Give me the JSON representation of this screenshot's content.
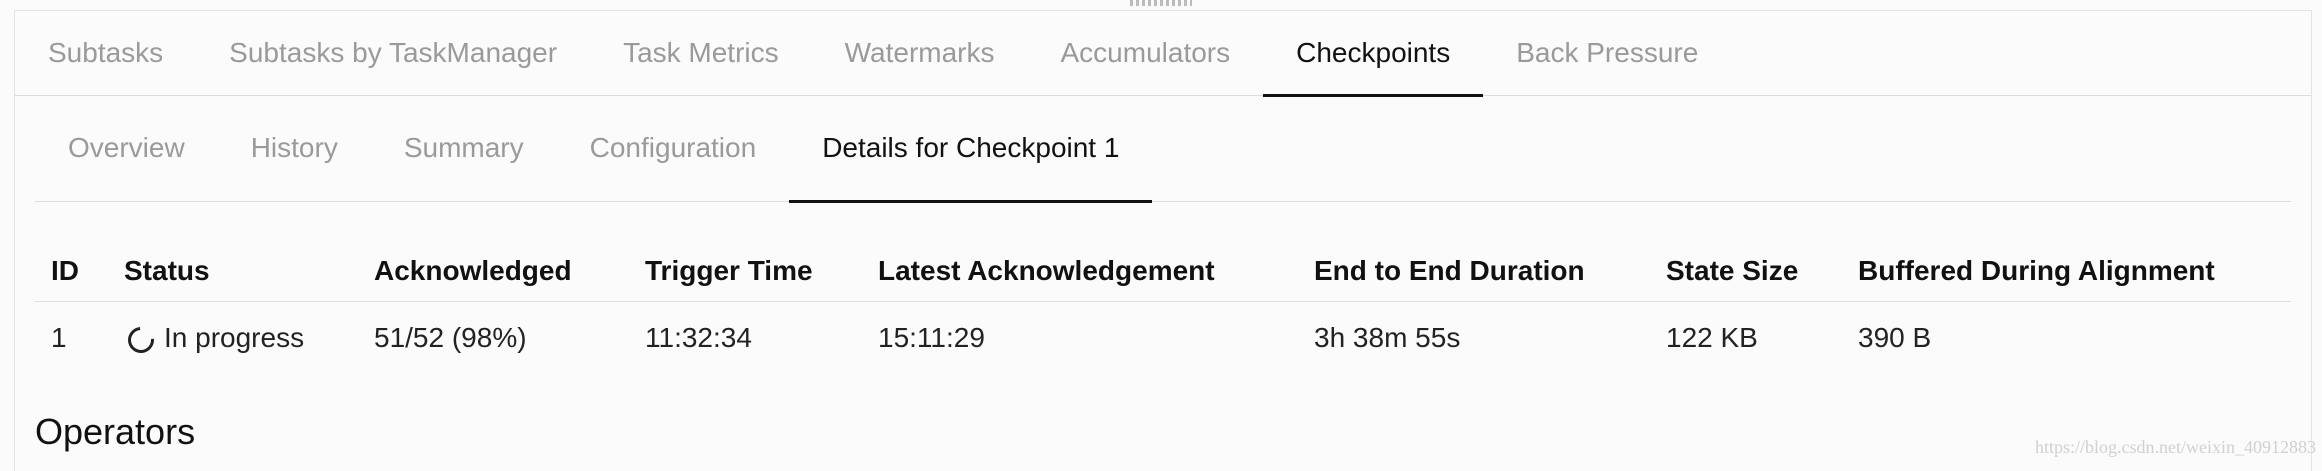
{
  "main_tabs": [
    {
      "label": "Subtasks"
    },
    {
      "label": "Subtasks by TaskManager"
    },
    {
      "label": "Task Metrics"
    },
    {
      "label": "Watermarks"
    },
    {
      "label": "Accumulators"
    },
    {
      "label": "Checkpoints",
      "active": true
    },
    {
      "label": "Back Pressure"
    }
  ],
  "sub_tabs": [
    {
      "label": "Overview"
    },
    {
      "label": "History"
    },
    {
      "label": "Summary"
    },
    {
      "label": "Configuration"
    },
    {
      "label": "Details for Checkpoint 1",
      "active": true
    }
  ],
  "table": {
    "headers": [
      "ID",
      "Status",
      "Acknowledged",
      "Trigger Time",
      "Latest Acknowledgement",
      "End to End Duration",
      "State Size",
      "Buffered During Alignment"
    ],
    "row": {
      "id": "1",
      "status": "In progress",
      "acknowledged": "51/52 (98%)",
      "trigger_time": "11:32:34",
      "latest_ack": "15:11:29",
      "duration": "3h 38m 55s",
      "state_size": "122 KB",
      "buffered": "390 B"
    }
  },
  "section_title": "Operators",
  "watermark": "https://blog.csdn.net/weixin_40912883"
}
